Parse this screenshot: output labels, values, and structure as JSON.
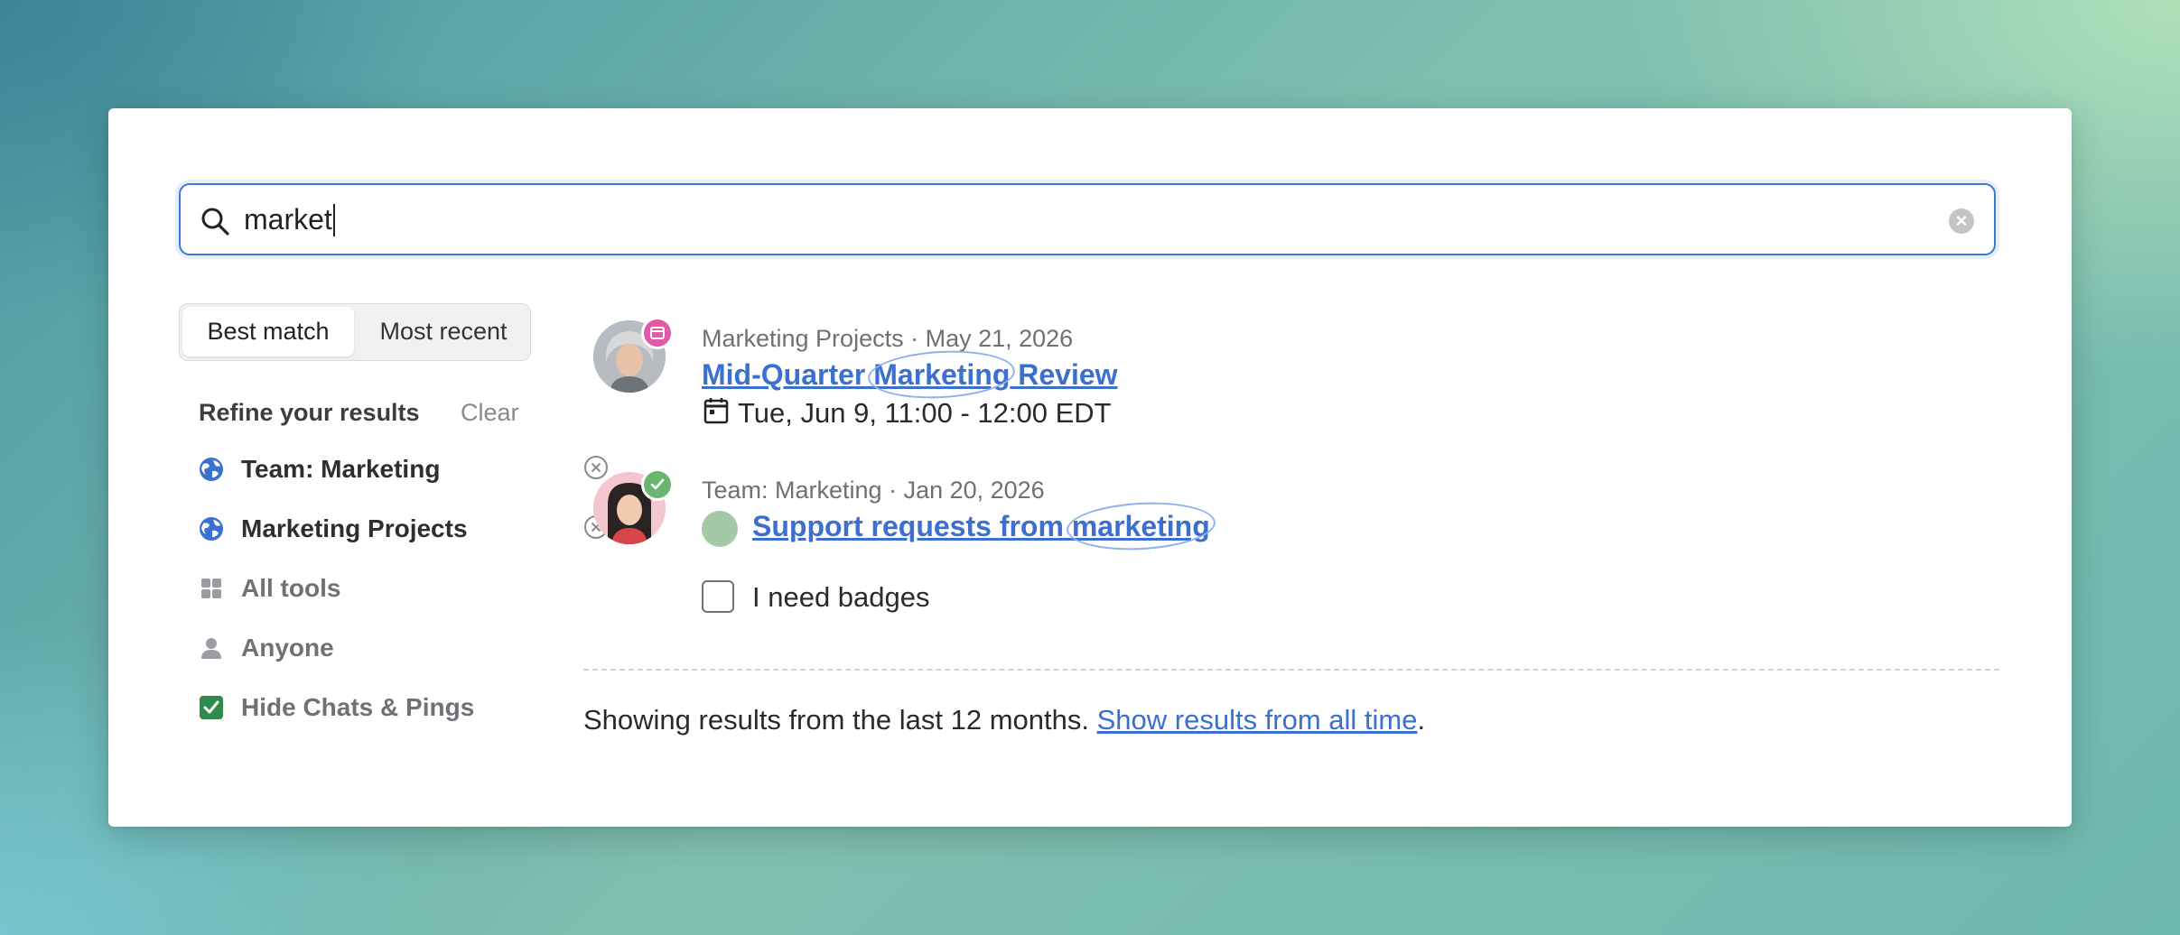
{
  "search": {
    "query": "market"
  },
  "sort": {
    "options": [
      "Best match",
      "Most recent"
    ],
    "active": "Best match"
  },
  "refine": {
    "title": "Refine your results",
    "clear_label": "Clear",
    "filters": [
      {
        "label": "Team: Marketing",
        "icon": "globe-icon",
        "removable": true
      },
      {
        "label": "Marketing Projects",
        "icon": "globe-icon",
        "removable": true
      },
      {
        "label": "All tools",
        "icon": "grid-icon",
        "removable": false
      },
      {
        "label": "Anyone",
        "icon": "person-icon",
        "removable": false
      },
      {
        "label": "Hide Chats & Pings",
        "icon": "checkbox-checked-icon",
        "removable": false
      }
    ]
  },
  "results": [
    {
      "meta": "Marketing Projects · May 21, 2026",
      "title_pre": "Mid-Quarter ",
      "title_hl": "Marketing",
      "title_post": " Review",
      "detail": "Tue, Jun 9, 11:00 - 12:00 EDT",
      "badge": "calendar-badge-icon"
    },
    {
      "meta": "Team: Marketing · Jan 20, 2026",
      "title_pre": "Support requests from ",
      "title_hl": "marketing",
      "title_post": "",
      "detail": "I need badges",
      "badge": "check-badge-icon"
    }
  ],
  "footer": {
    "text": "Showing results from the last 12 months. ",
    "link": "Show results from all time",
    "end": "."
  },
  "colors": {
    "accent": "#3b6fd0",
    "focus_border": "#3b78d8",
    "badge_pink": "#e05aa8",
    "badge_green": "#6ab56f"
  }
}
